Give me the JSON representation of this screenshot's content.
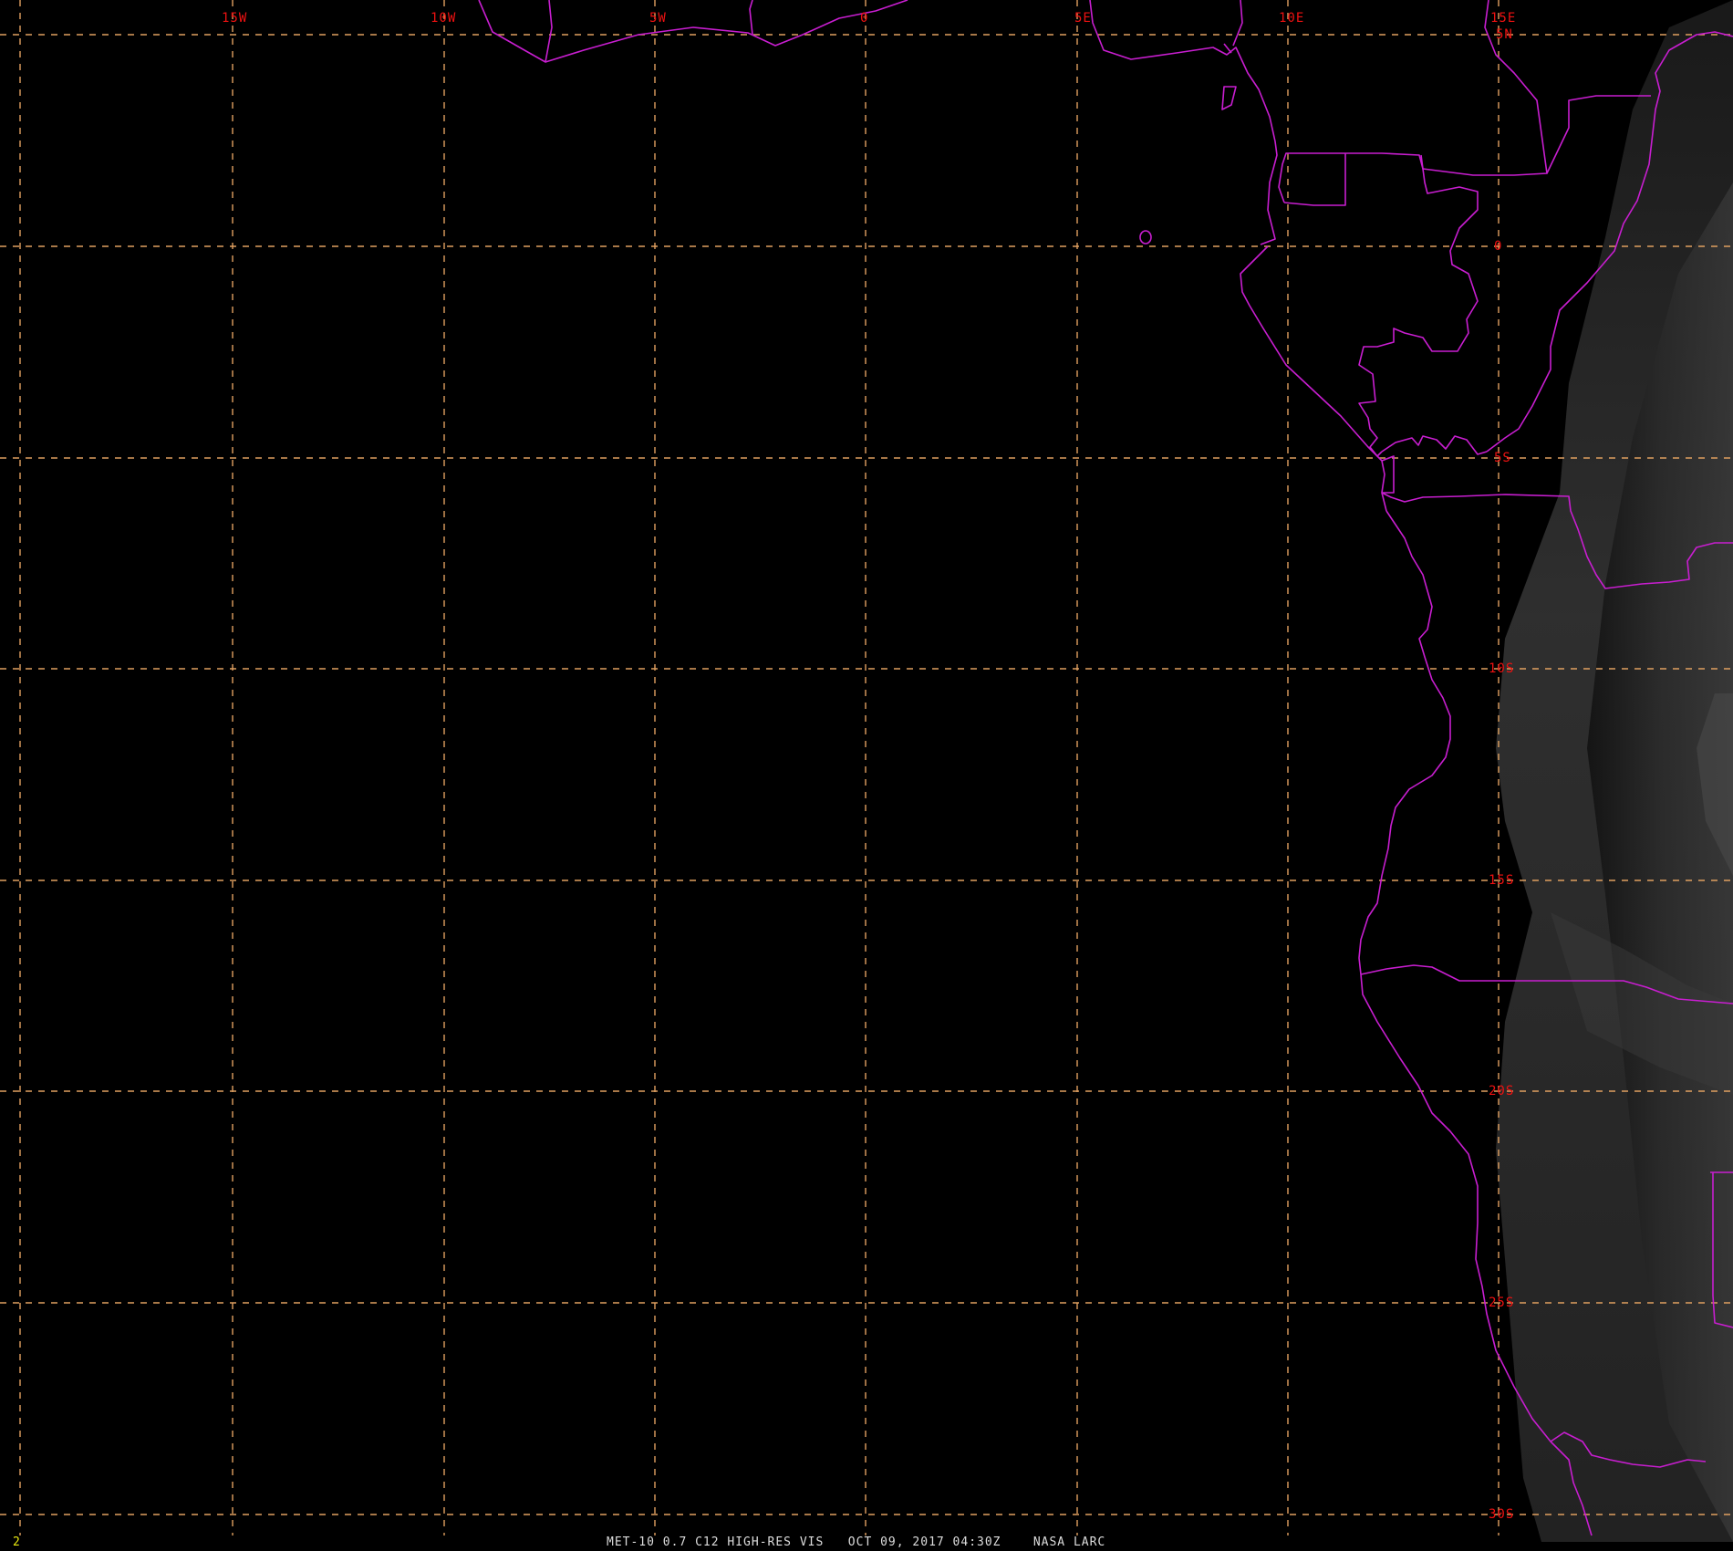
{
  "image": {
    "caption": "MET-10 0.7 C12 HIGH-RES VIS   OCT 09, 2017 04:30Z    NASA LARC",
    "frame_number": "2"
  },
  "grid": {
    "longitudes": [
      "15W",
      "10W",
      "5W",
      "0",
      "5E",
      "10E",
      "15E"
    ],
    "latitudes": [
      "5N",
      "0",
      "5S",
      "10S",
      "15S",
      "20S",
      "25S",
      "30S"
    ]
  },
  "colors": {
    "background": "#000000",
    "grid": "#e0a060",
    "grid_labels": "#ee1111",
    "borders": "#c81ed0",
    "caption": "#dddddd",
    "frame_number": "#e8e810"
  }
}
